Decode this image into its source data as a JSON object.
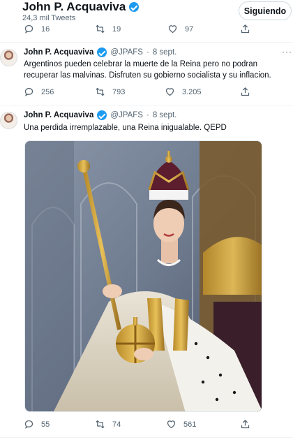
{
  "header": {
    "name": "John P. Acquaviva",
    "tweet_count": "24,3 mil Tweets",
    "follow_label": "Siguiendo"
  },
  "top_actions": {
    "replies": "16",
    "retweets": "19",
    "likes": "97"
  },
  "tweets": [
    {
      "author": "John P. Acquaviva",
      "handle": "@JPAFS",
      "dot": "·",
      "date": "8 sept.",
      "text": "Argentinos pueden celebrar la muerte de la Reina pero no podran recuperar las malvinas. Disfruten su gobierno socialista y su inflacion.",
      "replies": "256",
      "retweets": "793",
      "likes": "3.205"
    },
    {
      "author": "John P. Acquaviva",
      "handle": "@JPAFS",
      "dot": "·",
      "date": "8 sept.",
      "text": "Una perdida irremplazable, una Reina inigualable. QEPD",
      "replies": "55",
      "retweets": "74",
      "likes": "561"
    }
  ],
  "icons": {
    "verified": "verified-badge-icon",
    "reply": "reply-icon",
    "retweet": "retweet-icon",
    "like": "heart-icon",
    "share": "share-icon",
    "more": "more-icon"
  },
  "colors": {
    "verified_blue": "#1d9bf0",
    "secondary_text": "#536471",
    "primary_text": "#0f1419",
    "divider": "#eff3f4"
  }
}
